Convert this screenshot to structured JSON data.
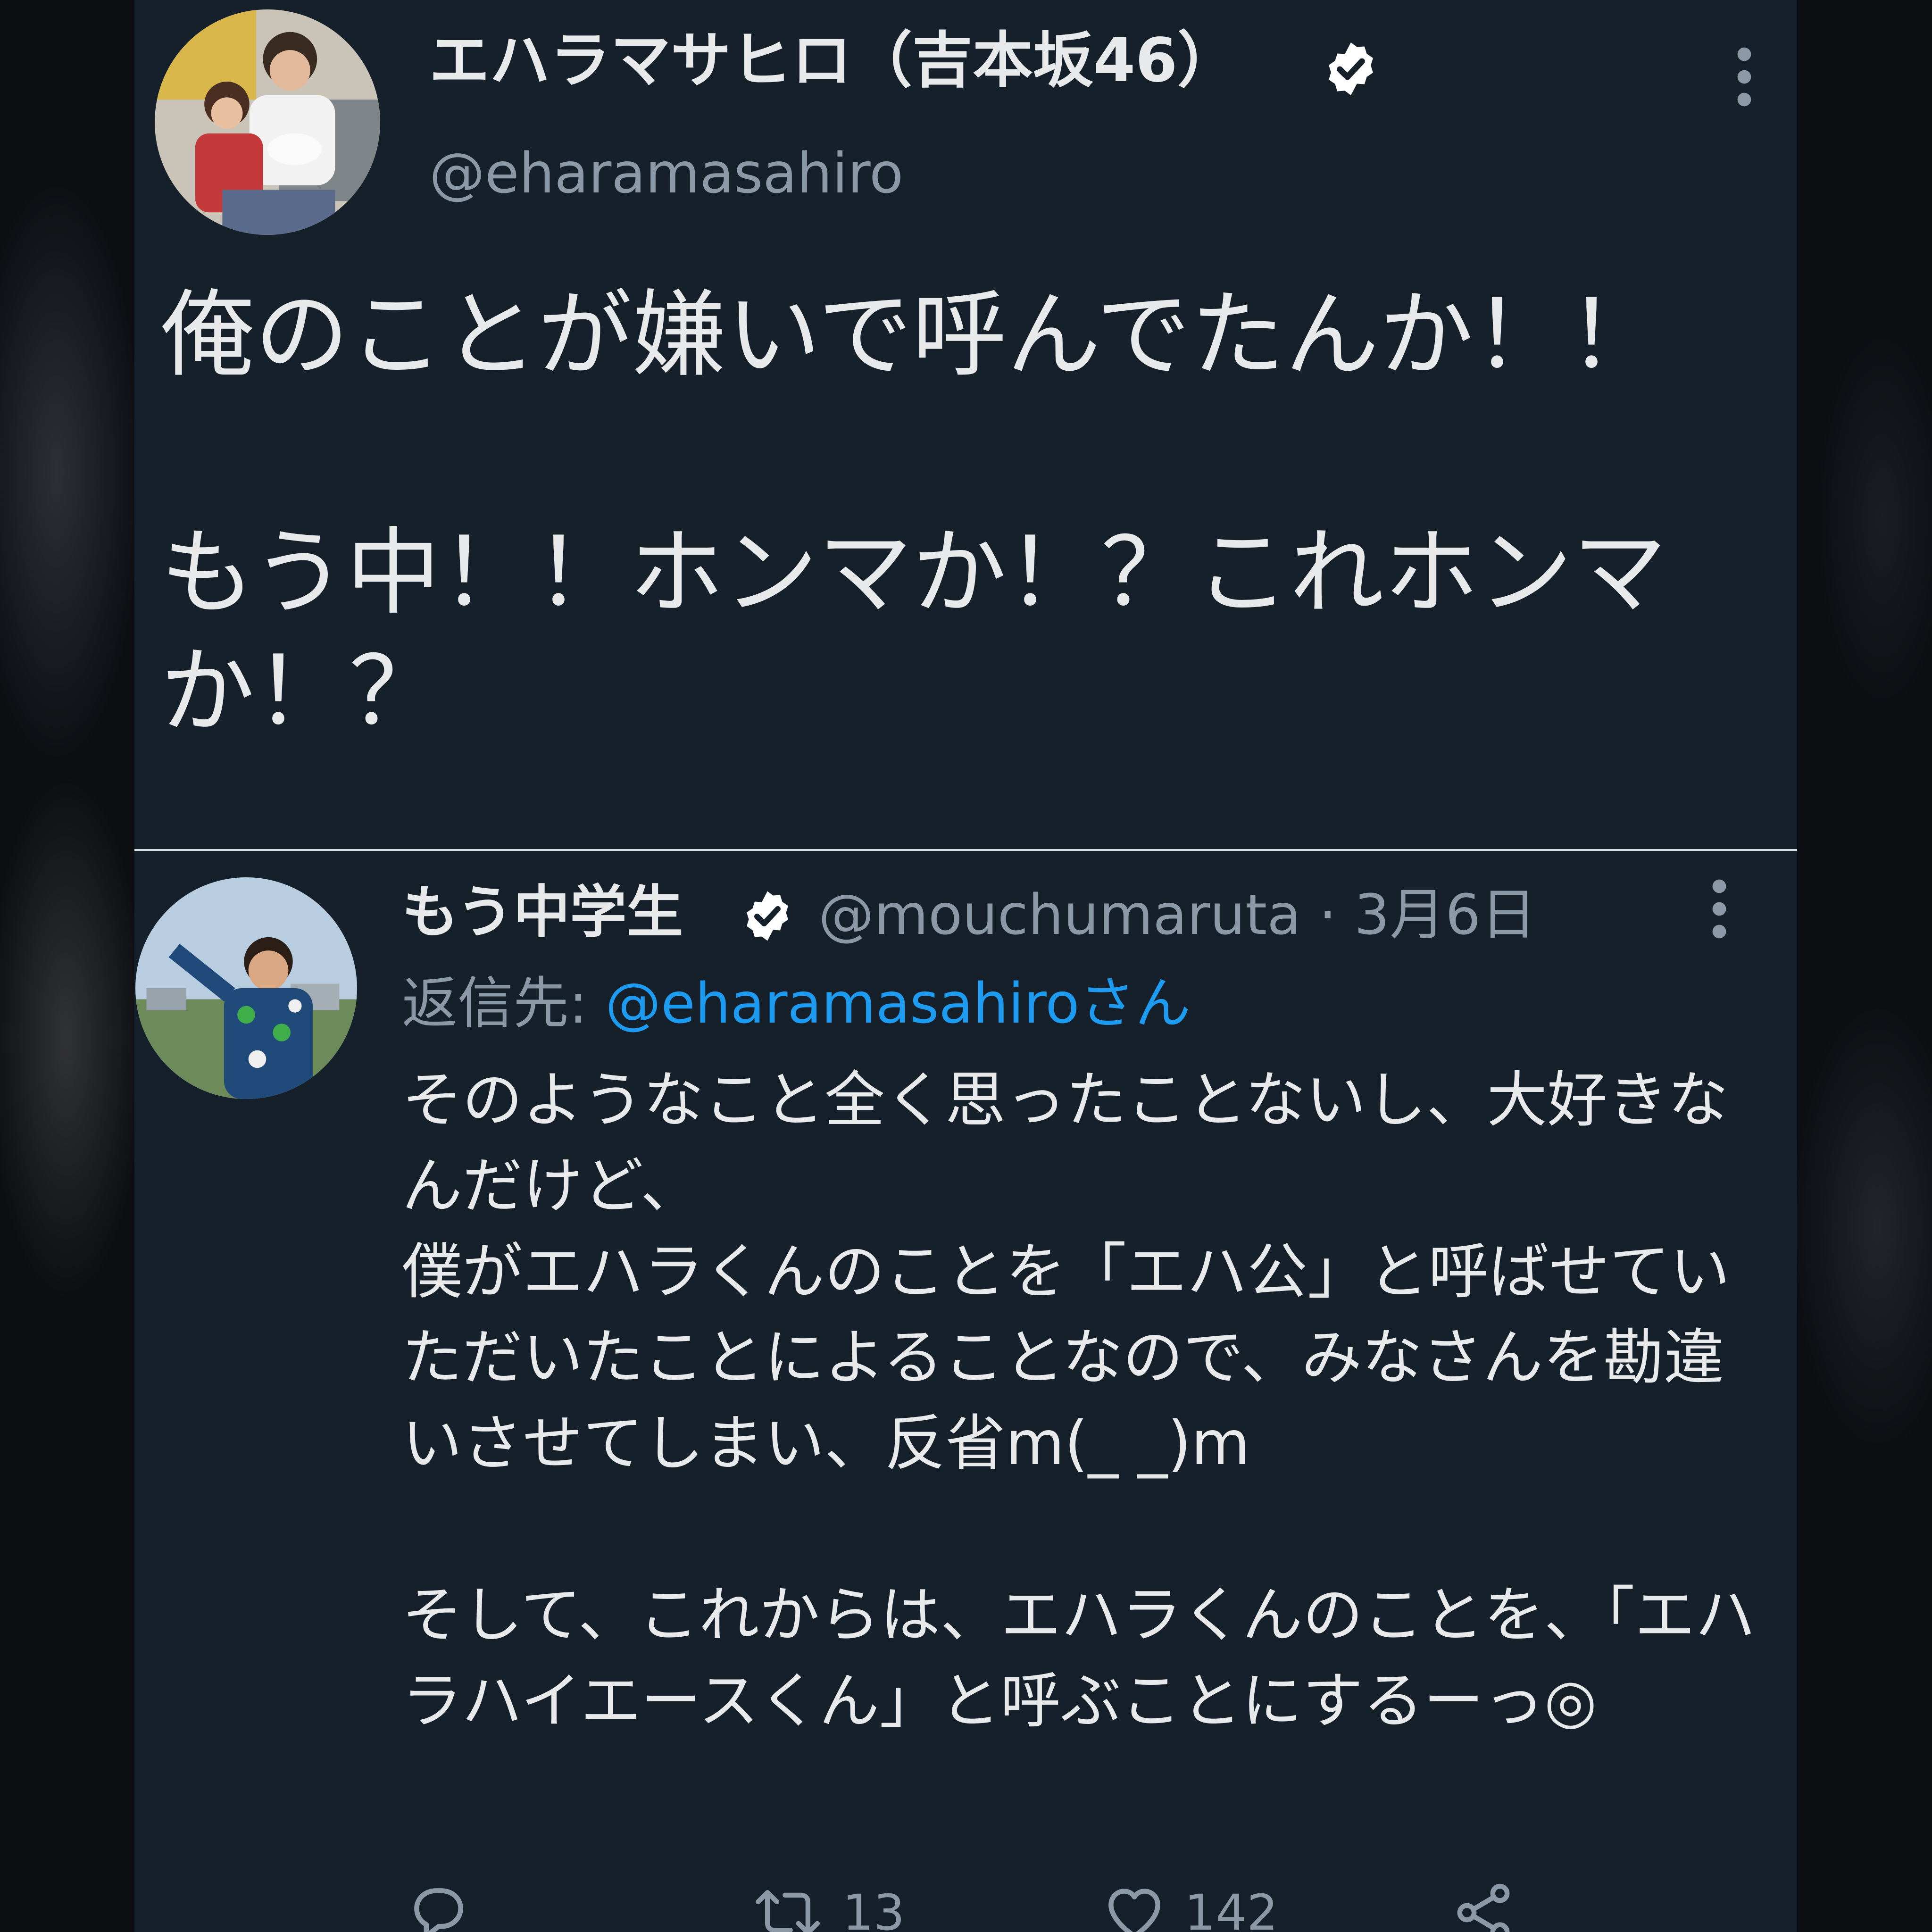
{
  "main_tweet": {
    "display_name": "エハラマサヒロ（吉本坂46）",
    "handle": "@eharamasahiro",
    "text": "俺のことが嫌いで呼んでたんか！！\n\nもう中！！ホンマか！？これホンマか！？"
  },
  "reply_tweet": {
    "display_name": "もう中学生",
    "handle_and_date": "@mouchumaruta · 3月6日",
    "reply_to_label": "返信先: ",
    "reply_to_mention": "@eharamasahiroさん",
    "text": "そのようなこと全く思ったことないし、大好きなんだけど、\n僕がエハラくんのことを「エハ公」と呼ばせていただいたことによることなので、みなさんを勘違いさせてしまい、反省m(_ _)m\n\nそして、これからは、エハラくんのことを、「エハラハイエースくん」と呼ぶことにするーっ◎",
    "actions": {
      "reply_count": "",
      "retweet_count": "13",
      "like_count": "142"
    }
  },
  "icons": {
    "verified": "verified-badge-icon",
    "more": "more-options-icon",
    "reply": "reply-bubble-icon",
    "retweet": "retweet-icon",
    "like": "heart-icon",
    "share": "share-icon"
  },
  "colors": {
    "background": "#15202b",
    "text_primary": "#e7e9ea",
    "text_secondary": "#8b98a5",
    "link": "#1d9bf0"
  }
}
